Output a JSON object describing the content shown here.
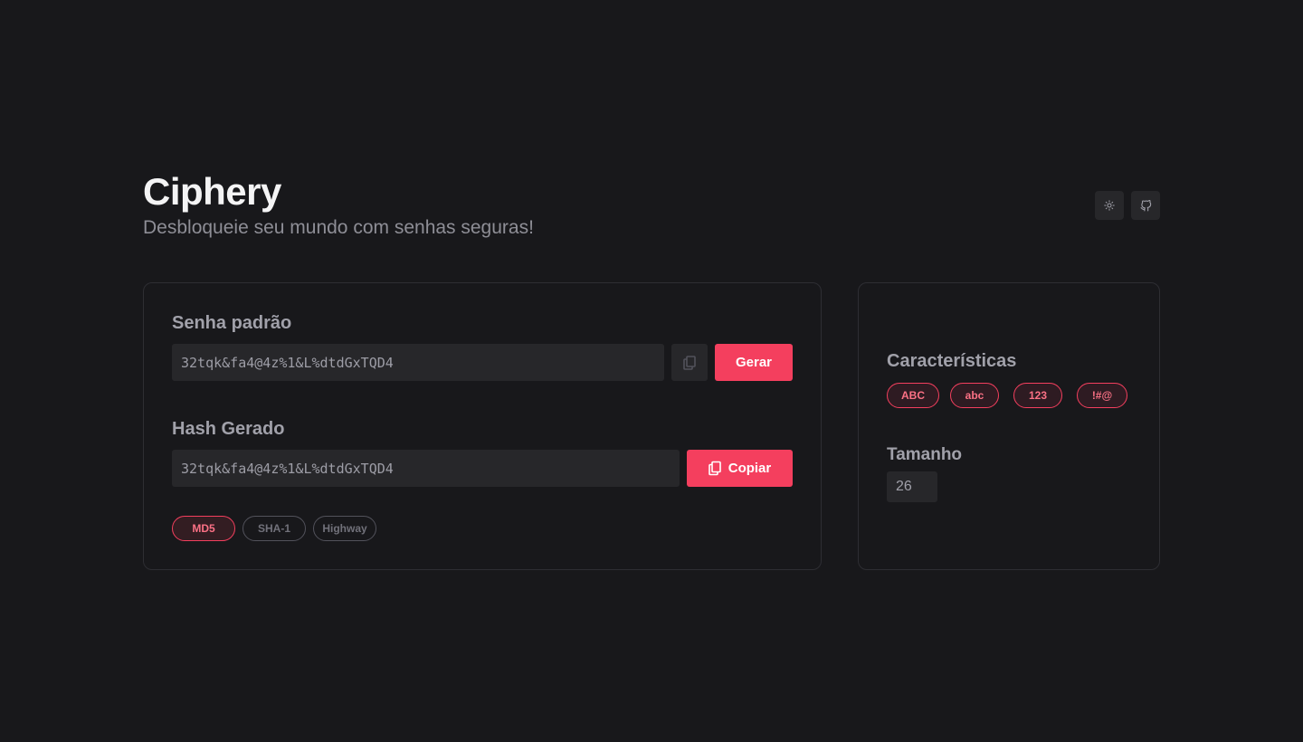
{
  "header": {
    "title": "Ciphery",
    "subtitle": "Desbloqueie seu mundo com senhas seguras!",
    "actions": [
      {
        "icon": "sun-icon"
      },
      {
        "icon": "github-icon"
      }
    ]
  },
  "password": {
    "label": "Senha padrão",
    "value": "32tqk&fa4@4z%1&L%dtdGxTQD4",
    "copy_icon": "copy-icon",
    "generate_label": "Gerar"
  },
  "hash": {
    "label": "Hash Gerado",
    "value": "32tqk&fa4@4z%1&L%dtdGxTQD4",
    "copy_label": "Copiar",
    "copy_icon": "copy-icon",
    "algorithms": [
      {
        "label": "MD5",
        "active": true
      },
      {
        "label": "SHA-1",
        "active": false
      },
      {
        "label": "Highway",
        "active": false
      }
    ]
  },
  "settings": {
    "features_label": "Características",
    "features": [
      {
        "label": "ABC",
        "active": true
      },
      {
        "label": "abc",
        "active": true
      },
      {
        "label": "123",
        "active": true
      },
      {
        "label": "!#@",
        "active": true
      }
    ],
    "size_label": "Tamanho",
    "size_value": "26"
  },
  "colors": {
    "background": "#18181b",
    "surface": "#27272a",
    "accent": "#f43f5e",
    "border": "#2e2e33"
  }
}
